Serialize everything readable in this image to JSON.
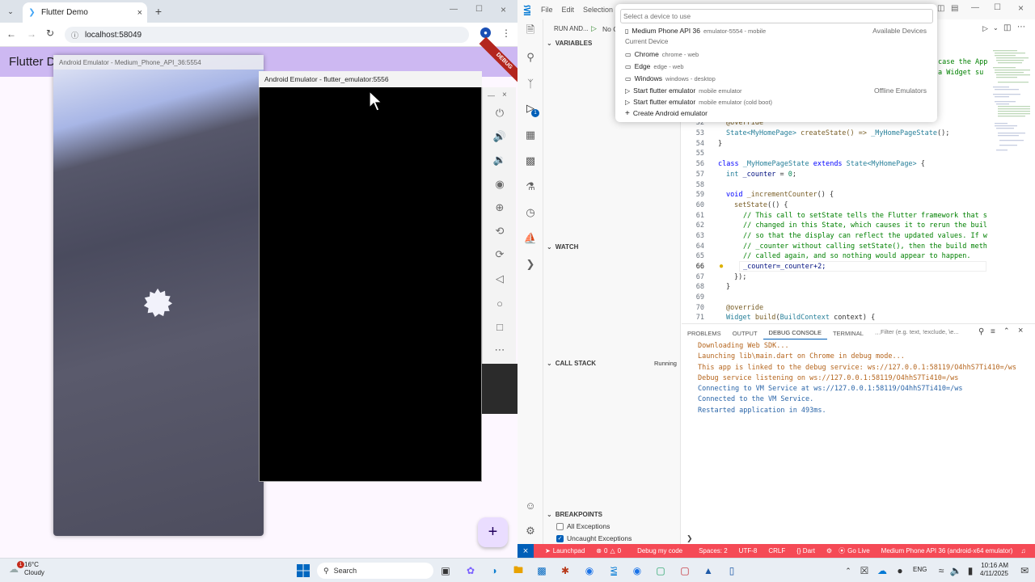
{
  "chrome": {
    "tab_title": "Flutter Demo",
    "url": "localhost:58049"
  },
  "flutter_app": {
    "title": "Flutter D",
    "debug_banner": "DEBUG",
    "fab_label": "+"
  },
  "emulator1": {
    "title": "Android Emulator - Medium_Phone_API_36:5554"
  },
  "emulator2": {
    "title": "Android Emulator - flutter_emulator:5556"
  },
  "vscode": {
    "menu": [
      "File",
      "Edit",
      "Selection"
    ],
    "run_label": "RUN AND...",
    "run_config": "No C",
    "sections": {
      "variables": "VARIABLES",
      "watch": "WATCH",
      "call_stack": "CALL STACK",
      "call_stack_status": "Running",
      "breakpoints": "BREAKPOINTS"
    },
    "breakpoints": [
      {
        "label": "All Exceptions",
        "checked": false
      },
      {
        "label": "Uncaught Exceptions",
        "checked": true
      }
    ],
    "partial_top": [
      "case the App",
      "a Widget su"
    ],
    "line_numbers": [
      "52",
      "53",
      "54",
      "55",
      "56",
      "57",
      "58",
      "59",
      "60",
      "61",
      "62",
      "63",
      "64",
      "65",
      "66",
      "67",
      "68",
      "69",
      "70",
      "71"
    ],
    "code": {
      "l52": "@override",
      "l53a": "State<MyHomePage>",
      "l53b": " createState() => ",
      "l53c": "_MyHomePageState",
      "l53d": "();",
      "l54": "}",
      "l56a": "class ",
      "l56b": "_MyHomePageState",
      "l56c": " extends ",
      "l56d": "State<MyHomePage>",
      "l56e": " {",
      "l57a": "int ",
      "l57b": "_counter",
      "l57c": " = ",
      "l57d": "0",
      "l57e": ";",
      "l59a": "void ",
      "l59b": "_incrementCounter",
      "l59c": "() {",
      "l60a": "setState",
      "l60b": "(() {",
      "l61": "// This call to setState tells the Flutter framework that s",
      "l62": "// changed in this State, which causes it to rerun the buil",
      "l63": "// so that the display can reflect the updated values. If w",
      "l64": "// _counter without calling setState(), then the build meth",
      "l65": "// called again, and so nothing would appear to happen.",
      "l66": "_counter=_counter+2;",
      "l67": "});",
      "l68": "}",
      "l70": "@override",
      "l71a": "Widget",
      "l71b": " build",
      "l71c": "(",
      "l71d": "BuildContext",
      "l71e": " context) {"
    },
    "panel_tabs": [
      "PROBLEMS",
      "OUTPUT",
      "DEBUG CONSOLE",
      "TERMINAL",
      "···"
    ],
    "filter_placeholder": "Filter (e.g. text, !exclude, \\e...",
    "console_lines": [
      {
        "text": "Downloading Web SDK...",
        "color": "#b5651d"
      },
      {
        "text": "Launching lib\\main.dart on Chrome in debug mode...",
        "color": "#b5651d"
      },
      {
        "text": "This app is linked to the debug service: ws://127.0.0.1:58119/O4hhS7Ti410=/ws",
        "color": "#b5651d"
      },
      {
        "text": "Debug service listening on ws://127.0.0.1:58119/O4hhS7Ti410=/ws",
        "color": "#b5651d"
      },
      {
        "text": "Connecting to VM Service at ws://127.0.0.1:58119/O4hhS7Ti410=/ws",
        "color": "#2a65a8"
      },
      {
        "text": "Connected to the VM Service.",
        "color": "#2a65a8"
      },
      {
        "text": "Restarted application in 493ms.",
        "color": "#2a65a8"
      }
    ],
    "status": {
      "launchpad": "Launchpad",
      "errors": "0",
      "warnings": "0",
      "debug": "Debug my code",
      "spaces": "Spaces: 2",
      "encoding": "UTF-8",
      "eol": "CRLF",
      "lang": "{} Dart",
      "golive": "Go Live",
      "device": "Medium Phone API 36 (android-x64 emulator)"
    },
    "quickpick": {
      "placeholder": "Select a device to use",
      "items": [
        {
          "icon": "phone-icon",
          "label": "Medium Phone API 36",
          "sub": "emulator-5554 - mobile",
          "right": "Available Devices",
          "selected": true
        },
        {
          "icon": "",
          "label": "Current Device",
          "sub": "",
          "right": "",
          "group": true
        },
        {
          "icon": "browser-icon",
          "label": "Chrome",
          "sub": "chrome - web",
          "right": ""
        },
        {
          "icon": "browser-icon",
          "label": "Edge",
          "sub": "edge - web",
          "right": ""
        },
        {
          "icon": "desktop-icon",
          "label": "Windows",
          "sub": "windows - desktop",
          "right": ""
        },
        {
          "icon": "play-icon",
          "label": "Start flutter emulator",
          "sub": "mobile emulator",
          "right": "Offline Emulators"
        },
        {
          "icon": "play-icon",
          "label": "Start flutter emulator",
          "sub": "mobile emulator (cold boot)",
          "right": ""
        },
        {
          "icon": "plus-icon",
          "label": "Create Android emulator",
          "sub": "",
          "right": ""
        }
      ]
    }
  },
  "taskbar": {
    "weather_temp": "16°C",
    "weather_desc": "Cloudy",
    "weather_badge": "1",
    "search": "Search",
    "lang": "ENG",
    "time": "10:16 AM",
    "date": "4/11/2025"
  },
  "colors": {
    "flutter_appbar": "#cdb8f2",
    "flutter_bg": "#fdf7ff",
    "vscode_status": "#f54a56",
    "vscode_accent": "#005fb8"
  }
}
